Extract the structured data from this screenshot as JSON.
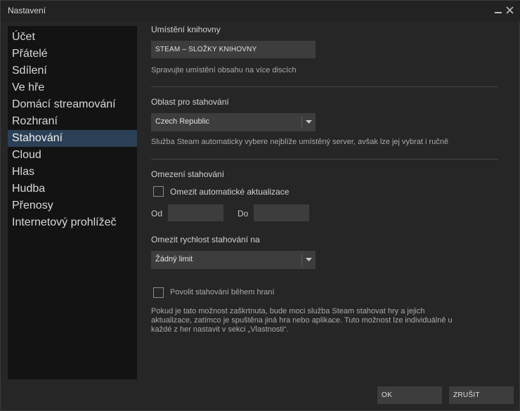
{
  "window": {
    "title": "Nastavení"
  },
  "sidebar": {
    "items": [
      {
        "label": "Účet"
      },
      {
        "label": "Přátelé"
      },
      {
        "label": "Sdílení"
      },
      {
        "label": "Ve hře"
      },
      {
        "label": "Domácí streamování"
      },
      {
        "label": "Rozhraní"
      },
      {
        "label": "Stahování",
        "active": true
      },
      {
        "label": "Cloud"
      },
      {
        "label": "Hlas"
      },
      {
        "label": "Hudba"
      },
      {
        "label": "Přenosy"
      },
      {
        "label": "Internetový prohlížeč"
      }
    ]
  },
  "library": {
    "heading": "Umístění knihovny",
    "button_label": "STEAM – SLOŽKY KNIHOVNY",
    "description": "Spravujte umístění obsahu na více discích"
  },
  "region": {
    "heading": "Oblast pro stahování",
    "selected": "Czech Republic",
    "description": "Služba Steam automaticky vybere nejblíže umístěný server, avšak lze jej vybrat i ručně"
  },
  "restrictions": {
    "heading": "Omezení stahování",
    "auto_update_label": "Omezit automatické aktualizace",
    "auto_update_checked": false,
    "from_label": "Od",
    "to_label": "Do",
    "from_value": "",
    "to_value": "",
    "speed_heading": "Omezit rychlost stahování na",
    "speed_selected": "Žádný limit",
    "ingame_label": "Povolit stahování během hraní",
    "ingame_checked": false,
    "ingame_description": "Pokud je tato možnost zaškrtnuta, bude moci služba Steam stahovat hry a jejich aktualizace, zatímco je spuštěna jiná hra nebo aplikace. Tuto možnost lze individuálně u každé z her nastavit v sekci „Vlastnosti“."
  },
  "footer": {
    "ok_label": "OK",
    "cancel_label": "ZRUŠIT"
  },
  "icons": {
    "minimize": "minimize-icon",
    "close": "close-icon",
    "dropdown": "chevron-down-icon"
  },
  "colors": {
    "active_item": "#2b3f56",
    "sidebar_bg": "#131313",
    "window_bg": "#262626",
    "control_bg": "#3d3d3d"
  }
}
